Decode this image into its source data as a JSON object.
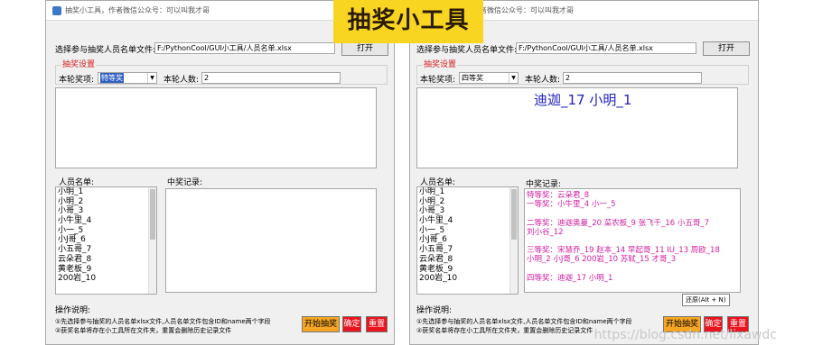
{
  "banner": "抽奖小工具",
  "windows": [
    {
      "id": "left",
      "title": "抽奖小工具，作者微信公众号：可以叫我才哥",
      "file_label": "选择参与抽奖人员名单文件:",
      "file_path": "F:/PythonCool/GUI小工具/人员名单.xlsx",
      "open_button": "打开",
      "group_title": "抽奖设置",
      "prize_label": "本轮奖项:",
      "prize_value": "特等奖",
      "count_label": "本轮人数:",
      "count_value": "2",
      "winner_text": "",
      "names_label": "人员名单:",
      "names": [
        "小明_1",
        "小明_2",
        "小哥_3",
        "小牛里_4",
        "小一_5",
        "小J哥_6",
        "小五哥_7",
        "云朵君_8",
        "黄老板_9",
        "200岩_10"
      ],
      "records_label": "中奖记录:",
      "records": [],
      "notes_title": "操作说明:",
      "notes": [
        "①先选择参与抽奖的人员名单xlsx文件,人员名单文件包含ID和name两个字段",
        "②获奖名单将存在小工具所在文件夹，重置会删除历史记录文件"
      ],
      "start_button": "开始抽奖",
      "confirm_button": "确定",
      "reset_button": "重置"
    },
    {
      "id": "right",
      "title": "抽奖小工具，作者微信公众号：可以叫我才哥",
      "file_label": "选择参与抽奖人员名单文件:",
      "file_path": "F:/PythonCool/GUI小工具/人员名单.xlsx",
      "open_button": "打开",
      "group_title": "抽奖设置",
      "prize_label": "本轮奖项:",
      "prize_value": "四等奖",
      "count_label": "本轮人数:",
      "count_value": "2",
      "winner_text": "迪迦_17   小明_1",
      "names_label": "人员名单:",
      "names": [
        "小明_1",
        "小明_2",
        "小哥_3",
        "小牛里_4",
        "小一_5",
        "小J哥_6",
        "小五哥_7",
        "云朵君_8",
        "黄老板_9",
        "200岩_10"
      ],
      "records_label": "中奖记录:",
      "records": [
        "特等奖：云朵君_8",
        "一等奖：小牛里_4   小一_5",
        "",
        "二等奖：迪迦奥曼_20   菜农板_9   张飞千_16   小五哥_7",
        "刘小谷_12",
        "",
        "三等奖：宋慧乔_19   赵本_14   早起哥_11   IU_13   周欧_18",
        "小明_2   小J哥_6   200岩_10   苏轼_15   才哥_3",
        "",
        "四等奖：迪迦_17   小明_1"
      ],
      "notes_title": "操作说明:",
      "notes": [
        "①先选择参与抽奖的人员名单xlsx文件,人员名单文件包含ID和name两个字段",
        "②获奖名单将存在小工具所在文件夹，重置会删除历史记录文件"
      ],
      "start_button": "开始抽奖",
      "confirm_button": "确定",
      "reset_button": "重置",
      "tooltip": "还原(Alt + N)"
    }
  ],
  "watermark": "https://blog.csdn.net/lixawdc",
  "colors": {
    "banner_bg": "#f8d520",
    "group_title": "#d42020",
    "record_text": "#d020a0",
    "winner_text": "#2020c0",
    "start_button": "#f5a623",
    "red_button": "#e8141e"
  }
}
